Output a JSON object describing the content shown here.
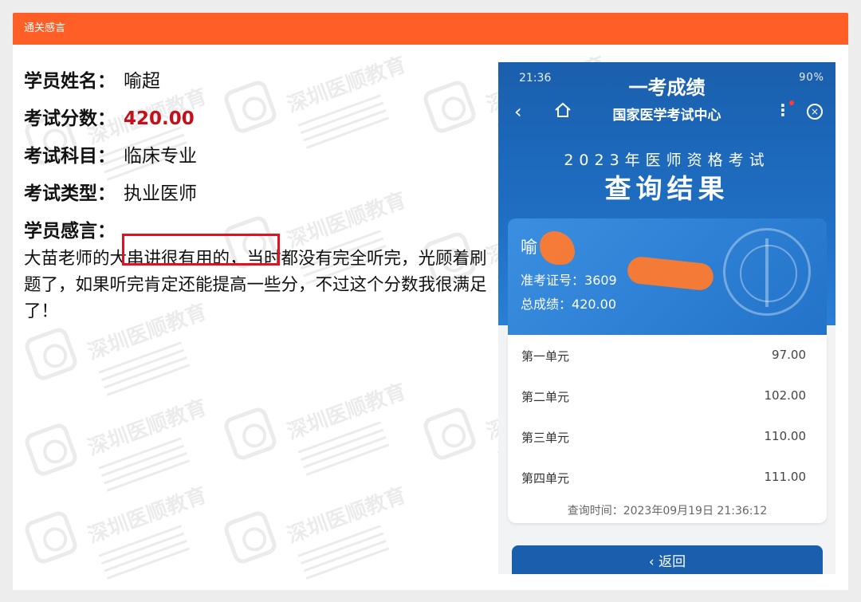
{
  "header": {
    "title": "通关感言"
  },
  "student": {
    "name_label": "学员姓名：",
    "name": "喻超",
    "score_label": "考试分数：",
    "score": "420.00",
    "subject_label": "考试科目：",
    "subject": "临床专业",
    "type_label": "考试类型：",
    "type": "执业医师",
    "comment_label": "学员感言：",
    "comment": "大苗老师的大串讲很有用的，当时都没有完全听完，光顾着刷题了，如果听完肯定还能提高一些分，不过这个分数我很满足了！"
  },
  "watermark": {
    "brand": "深圳医顺教育"
  },
  "phone": {
    "status_time": "21:36",
    "status_battery": "90%",
    "overlay_title": "一考成绩",
    "nav_title": "国家医学考试中心",
    "nav_back_icon": "chevron-left-icon",
    "nav_home_icon": "home-icon",
    "nav_more_icon": "more-vertical-icon",
    "nav_close_icon": "close-circle-icon",
    "exam_subtitle": "2023年医师资格考试",
    "exam_title": "查询结果",
    "result": {
      "name_partial": "喻",
      "ticket_label": "准考证号：",
      "ticket_partial": "3609",
      "total_label": "总成绩：",
      "total_value": "420.00"
    },
    "units": [
      {
        "label": "第一单元",
        "value": "97.00"
      },
      {
        "label": "第二单元",
        "value": "102.00"
      },
      {
        "label": "第三单元",
        "value": "110.00"
      },
      {
        "label": "第四单元",
        "value": "111.00"
      }
    ],
    "query_time_label": "查询时间：",
    "query_time": "2023年09月19日 21:36:12",
    "back_label": "返回",
    "back_icon": "chevron-left-icon"
  },
  "colors": {
    "header_bg": "#ff5f26",
    "score_red": "#c4101b",
    "highlight_red": "#e0121f",
    "phone_blue": "#1a5fad"
  }
}
